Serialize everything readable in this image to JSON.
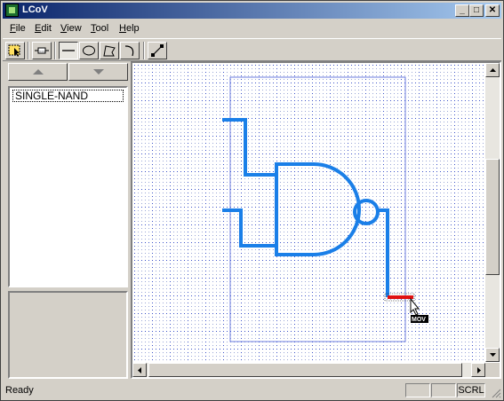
{
  "window": {
    "title": "LCoV"
  },
  "titlebar": {
    "min_glyph": "_",
    "max_glyph": "□",
    "close_glyph": "✕"
  },
  "menu": {
    "file": {
      "key": "F",
      "rest": "ile"
    },
    "edit": {
      "key": "E",
      "rest": "dit"
    },
    "view": {
      "key": "V",
      "rest": "iew"
    },
    "tool": {
      "key": "T",
      "rest": "ool"
    },
    "help": {
      "key": "H",
      "rest": "elp"
    }
  },
  "toolbar": {
    "tools": [
      "select-tool-icon",
      "resistor-tool-icon",
      "line-tool-icon",
      "ellipse-tool-icon",
      "polygon-tool-icon",
      "arc-tool-icon",
      "wire-tool-icon"
    ],
    "active_tool": "line-tool-icon"
  },
  "sidebar": {
    "items": [
      {
        "label": "SINGLE-NAND"
      }
    ]
  },
  "canvas": {
    "cursor_tooltip": "MOV",
    "wire_color": "#1a7fe8",
    "selected_color": "#e01010",
    "grid_color": "#3a50c8"
  },
  "status": {
    "text": "Ready",
    "panels": [
      "",
      "",
      "SCRL"
    ]
  }
}
